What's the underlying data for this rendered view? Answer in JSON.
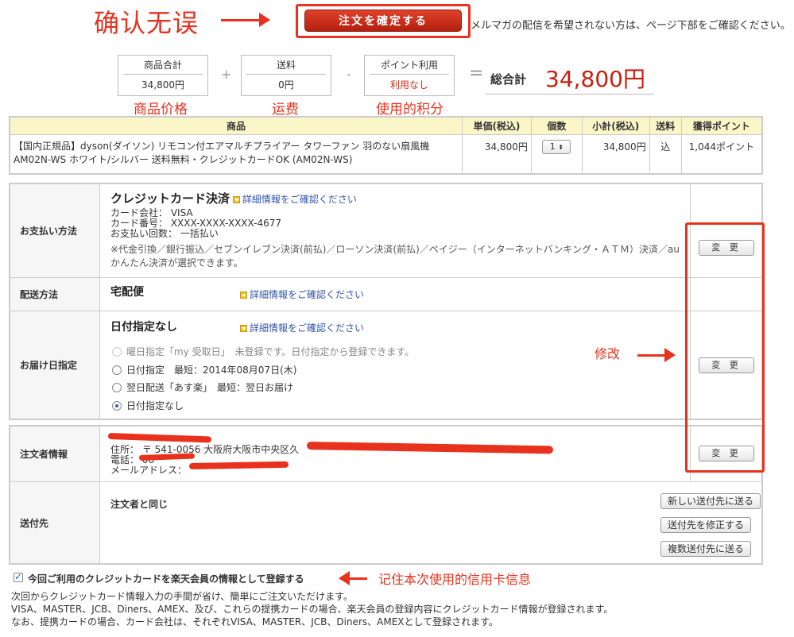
{
  "annotations": {
    "confirm": "确认无误",
    "goods_price": "商品价格",
    "shipping": "运费",
    "points": "使用的积分",
    "modify": "修改",
    "remember_card": "记住本次使用的信用卡信息"
  },
  "confirm_button": "注文を確定する",
  "top_note": "メルマガの配信を希望されない方は、ページ下部をご確認ください。",
  "totals": {
    "goods_label": "商品合計",
    "goods_value": "34,800円",
    "plus": "+",
    "shipping_label": "送料",
    "shipping_value": "0円",
    "minus": "-",
    "points_label": "ポイント利用",
    "points_value": "利用なし",
    "equals": "=",
    "grand_label": "総合計",
    "grand_value": "34,800円"
  },
  "product_table": {
    "headers": [
      "商品",
      "単価(税込)",
      "個数",
      "小計(税込)",
      "送料",
      "獲得ポイント"
    ],
    "row": {
      "name": "【国内正規品】dyson(ダイソン) リモコン付エアマルチプライアー タワーファン 羽のない扇風機 AM02N-WS ホワイト/シルバー 送料無料・クレジットカードOK (AM02N-WS)",
      "unit_price": "34,800円",
      "quantity": "1",
      "subtotal": "34,800円",
      "shipping": "込",
      "points": "1,044ポイント"
    }
  },
  "payment": {
    "label": "お支払い方法",
    "title": "クレジットカード決済",
    "detail_link": "詳細情報をご確認ください",
    "card_company": "カード会社： VISA",
    "card_number": "カード番号： XXXX-XXXX-XXXX-4677",
    "installments": "お支払い回数： 一括払い",
    "note": "※代金引換／銀行振込／セブンイレブン決済(前払)／ローソン決済(前払)／ペイジー（インターネットバンキング・ＡＴＭ）決済／auかんたん決済が選択できます。",
    "change": "変 更"
  },
  "delivery": {
    "label": "配送方法",
    "title": "宅配便",
    "detail_link": "詳細情報をご確認ください"
  },
  "delivery_date": {
    "label": "お届け日指定",
    "title": "日付指定なし",
    "detail_link": "詳細情報をご確認ください",
    "options": [
      "曜日指定「my 受取日」　未登録です。日付指定から登録できます。",
      "日付指定　最短：2014年08月07日(木)",
      "翌日配送「あす楽」　最短：翌日お届け",
      "日付指定なし"
    ],
    "change": "変 更"
  },
  "orderer": {
    "label": "注文者情報",
    "address": "住所： 〒 541-0056 大阪府大阪市中央区久",
    "phone": "電話： 06",
    "email": "メールアドレス：",
    "change": "変 更"
  },
  "ship_to": {
    "label": "送付先",
    "value": "注文者と同じ",
    "buttons": [
      "新しい送付先に送る",
      "送付先を修正する",
      "複数送付先に送る"
    ]
  },
  "register_card": {
    "label": "今回ご利用のクレジットカードを楽天会員の情報として登録する",
    "desc1": "次回からクレジットカード情報入力の手間が省け、簡単にご注文いただけます。",
    "desc2": "VISA、MASTER、JCB、Diners、AMEX、及び、これらの提携カードの場合、楽天会員の登録内容にクレジットカード情報が登録されます。",
    "desc3": "なお、提携カードの場合、カード会社は、それぞれVISA、MASTER、JCB、Diners、AMEXとして登録されます。"
  }
}
